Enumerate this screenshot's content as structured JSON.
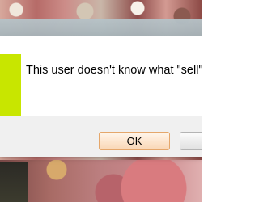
{
  "dialog": {
    "message": "This user doesn't know what \"sell\" m",
    "ok_label": "OK",
    "second_label": ""
  },
  "colors": {
    "icon_background": "#c8e600",
    "ok_button_border": "#e5a76b",
    "footer_background": "#f0f0f0"
  }
}
